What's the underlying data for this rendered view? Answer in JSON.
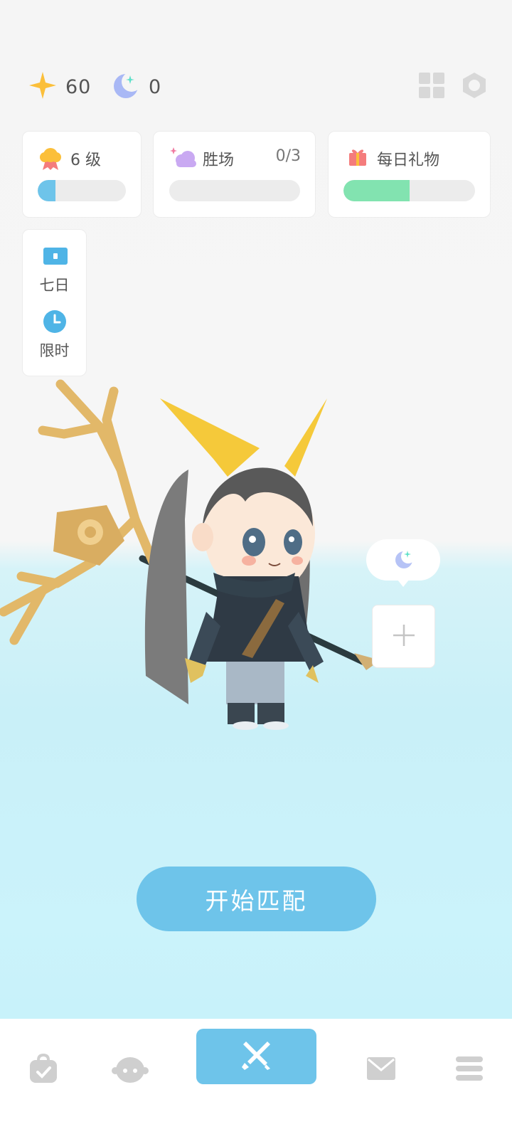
{
  "currencies": [
    {
      "icon": "star-icon",
      "value": "60",
      "color": "#fbbf3a"
    },
    {
      "icon": "moon-icon",
      "value": "0",
      "color": "#a9b8f5"
    }
  ],
  "top_icons": [
    "grid-icon",
    "settings-hexagon-icon"
  ],
  "level_card": {
    "label": "6 级",
    "progress": 0.2,
    "bar_color": "#6ec4ea"
  },
  "wins_card": {
    "label": "胜场",
    "count": "0/3",
    "progress": 0
  },
  "gift_card": {
    "label": "每日礼物",
    "progress": 0.5,
    "bar_color": "#82e3b0"
  },
  "side_panel": {
    "seven_day_label": "七日",
    "limited_label": "限时"
  },
  "start_button": {
    "label": "开始匹配"
  },
  "bottom_nav": [
    {
      "icon": "bag-icon",
      "active": false
    },
    {
      "icon": "character-icon",
      "active": false
    },
    {
      "icon": "battle-swords-icon",
      "active": true
    },
    {
      "icon": "mail-icon",
      "active": false
    },
    {
      "icon": "menu-icon",
      "active": false
    }
  ],
  "colors": {
    "accent": "#6ec4ea",
    "background_top": "#f5f5f5",
    "background_bottom": "#c9f0f8"
  }
}
